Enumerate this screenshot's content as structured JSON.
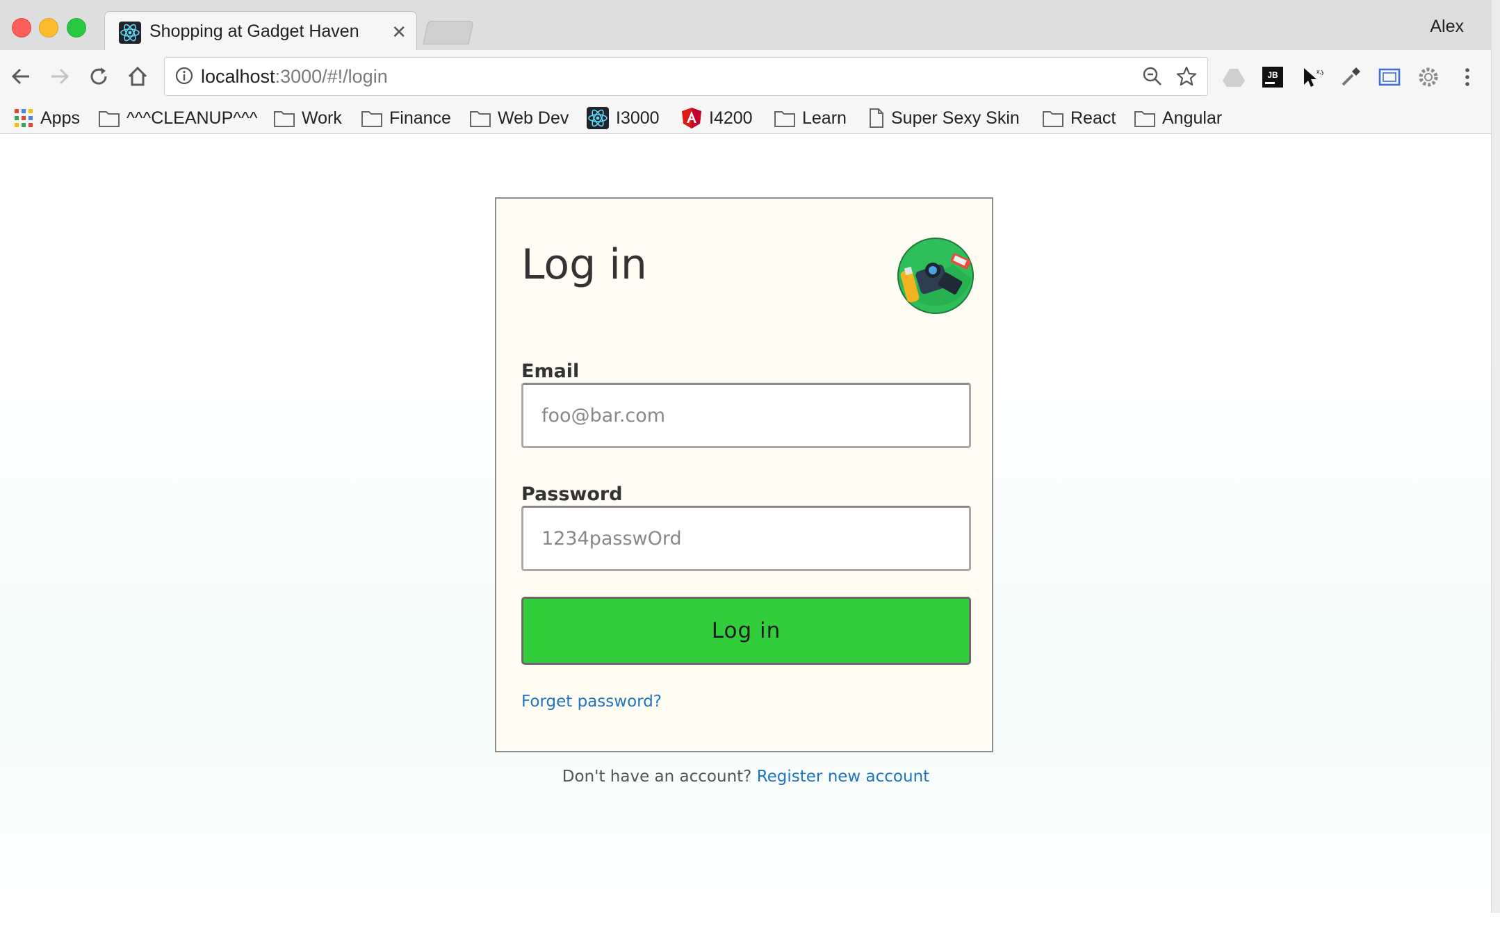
{
  "browser": {
    "tab_title": "Shopping at Gadget Haven",
    "profile_name": "Alex",
    "url_host": "localhost",
    "url_rest": ":3000/#!/login",
    "bookmarks": [
      {
        "label": "Apps",
        "icon": "apps-grid-icon"
      },
      {
        "label": "^^^CLEANUP^^^",
        "icon": "folder-icon"
      },
      {
        "label": "Work",
        "icon": "folder-icon"
      },
      {
        "label": "Finance",
        "icon": "folder-icon"
      },
      {
        "label": "Web Dev",
        "icon": "folder-icon"
      },
      {
        "label": "I3000",
        "icon": "react-icon"
      },
      {
        "label": "I4200",
        "icon": "angular-icon"
      },
      {
        "label": "Learn",
        "icon": "folder-icon"
      },
      {
        "label": "Super Sexy Skin",
        "icon": "page-icon"
      },
      {
        "label": "React",
        "icon": "folder-icon"
      },
      {
        "label": "Angular",
        "icon": "folder-icon"
      }
    ]
  },
  "login": {
    "title": "Log in",
    "email_label": "Email",
    "email_placeholder": "foo@bar.com",
    "password_label": "Password",
    "password_placeholder": "1234passwOrd",
    "submit_label": "Log in",
    "forgot_label": "Forget password?",
    "register_prompt": "Don't have an account?",
    "register_link": "Register new account"
  },
  "colors": {
    "accent_green": "#32cd3a",
    "link_blue": "#1e74c4",
    "card_bg": "#fffcf3"
  }
}
